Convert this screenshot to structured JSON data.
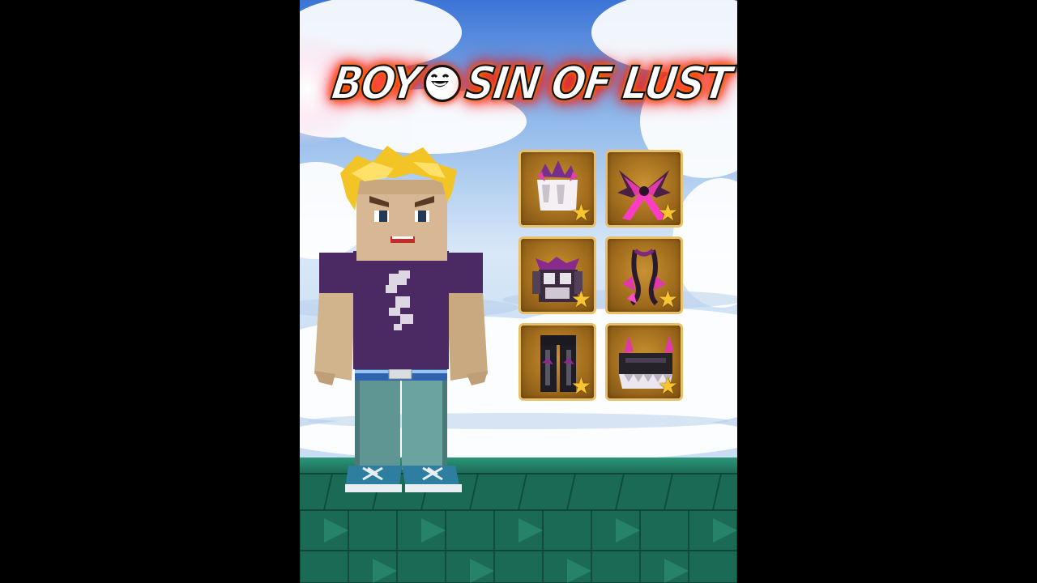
{
  "title": {
    "left_text": "BOY",
    "right_text": "SIN OF LUST",
    "glow_color": "#ff2000",
    "emoji_icon": "grinning-face-icon"
  },
  "character": {
    "hair_color": "#f2c425",
    "shirt_color": "#4b2a63",
    "pants_color": "#5f9693",
    "shoe_color": "#2d7ea0"
  },
  "items": [
    {
      "name": "white-claw-gloves-item",
      "rarity_icon": "star-icon"
    },
    {
      "name": "pink-dark-wings-item",
      "rarity_icon": "star-icon"
    },
    {
      "name": "dark-armor-top-item",
      "rarity_icon": "star-icon"
    },
    {
      "name": "pink-tail-item",
      "rarity_icon": "star-icon"
    },
    {
      "name": "dark-pants-item",
      "rarity_icon": "star-icon"
    },
    {
      "name": "spiked-crown-boots-item",
      "rarity_icon": "star-icon"
    }
  ],
  "colors": {
    "slot_gold": "#c99232",
    "slot_border": "#e9c06a",
    "star": "#f6c531",
    "floor": "#1f7a62",
    "sky_top": "#3c74d6"
  }
}
